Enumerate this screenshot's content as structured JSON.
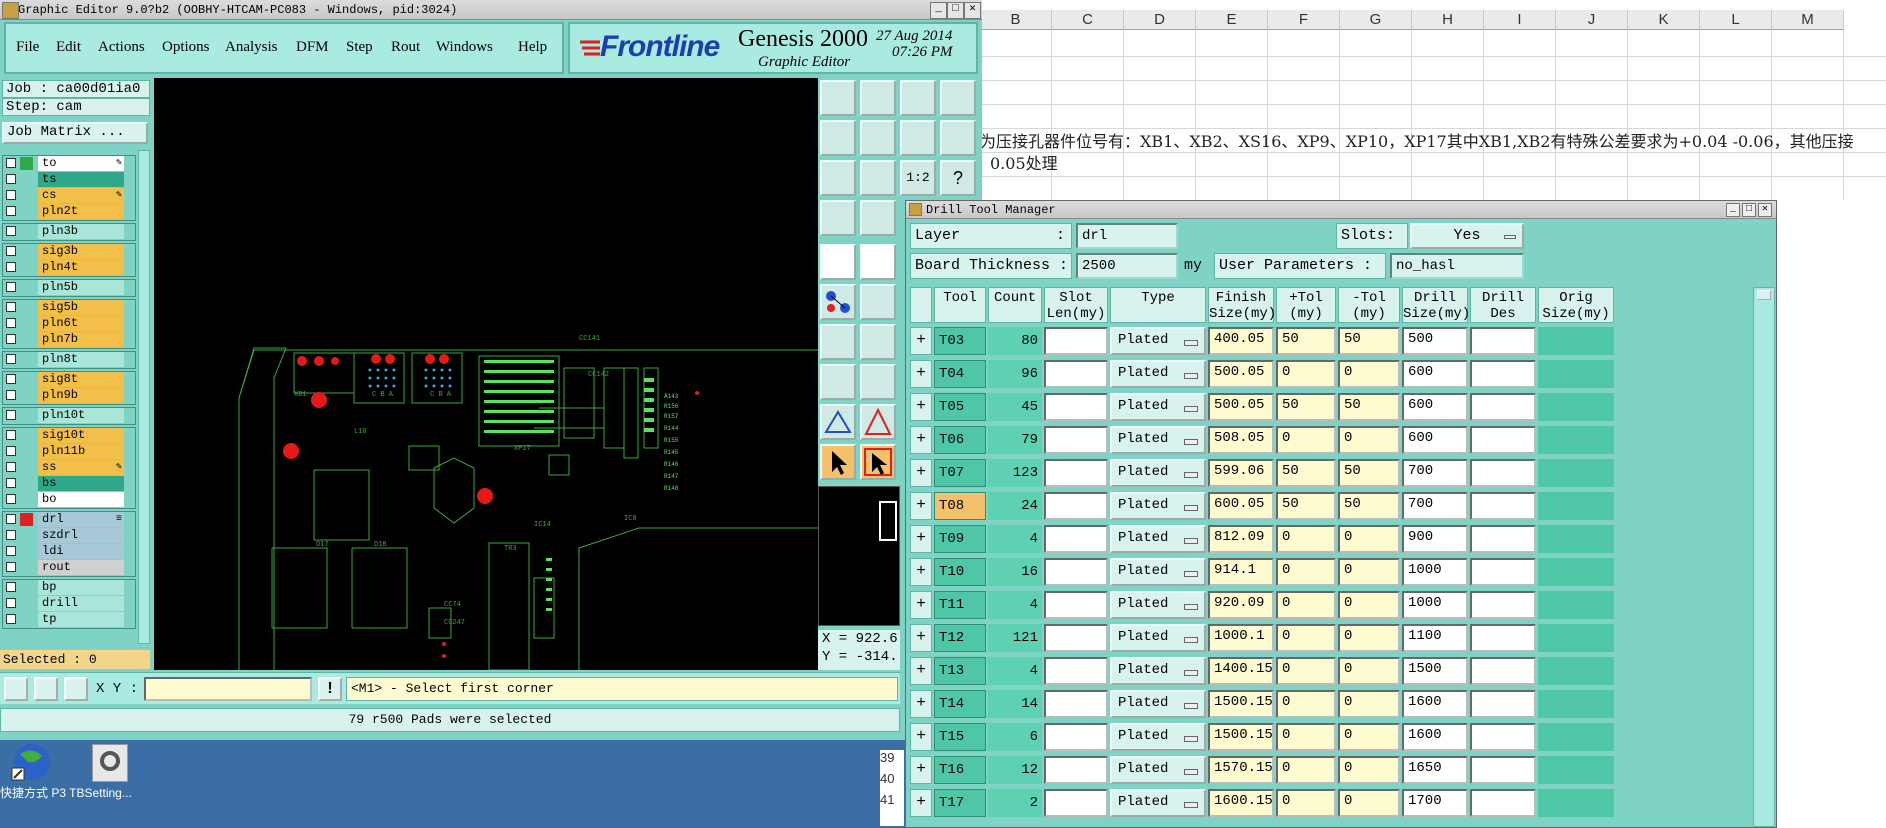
{
  "sheet": {
    "columns": [
      "B",
      "C",
      "D",
      "E",
      "F",
      "G",
      "H",
      "I",
      "J",
      "K",
      "L",
      "M"
    ],
    "note_line1": "为压接孔器件位号有：XB1、XB2、XS16、XP9、XP10，XP17其中XB1,XB2有特殊公差要求为+0.04 -0.06，其他压接",
    "note_line2": "0.05处理",
    "row_numbers": [
      "39",
      "40",
      "41"
    ]
  },
  "ge": {
    "title": "Graphic Editor 9.0?b2  (OOBHY-HTCAM-PC083 - Windows, pid:3024)",
    "menu": [
      "File",
      "Edit",
      "Actions",
      "Options",
      "Analysis",
      "DFM",
      "Step",
      "Rout",
      "Windows",
      "Help"
    ],
    "brand": "Frontline",
    "product": "Genesis 2000",
    "subtitle": "Graphic Editor",
    "date": "27 Aug 2014",
    "time": "07:26 PM",
    "job": "Job : ca00d01ia0",
    "step": "Step: cam",
    "job_matrix": "Job Matrix ...",
    "selected": "Selected : 0",
    "coords_x": "X = 922.6",
    "coords_y": "Y = -314.",
    "xy_label": "X Y :",
    "xy_value": "",
    "prompt": "<M1> - Select first corner",
    "status": "79 r500 Pads were selected",
    "layers": [
      {
        "name": "to",
        "bg": "#ffffff",
        "sw": "#2ea84a",
        "mark": "✎"
      },
      {
        "name": "ts",
        "bg": "#2ea889",
        "sw": "",
        "mark": ""
      },
      {
        "name": "cs",
        "bg": "#f2c04a",
        "sw": "",
        "mark": "✎"
      },
      {
        "name": "pln2t",
        "bg": "#f2c04a",
        "sw": "",
        "mark": ""
      },
      {
        "name": "pln3b",
        "bg": "#a8e6da",
        "sw": "",
        "mark": ""
      },
      {
        "name": "sig3b",
        "bg": "#f2c04a",
        "sw": "",
        "mark": ""
      },
      {
        "name": "pln4t",
        "bg": "#f2c04a",
        "sw": "",
        "mark": ""
      },
      {
        "name": "pln5b",
        "bg": "#a8e6da",
        "sw": "",
        "mark": ""
      },
      {
        "name": "sig5b",
        "bg": "#f2c04a",
        "sw": "",
        "mark": ""
      },
      {
        "name": "pln6t",
        "bg": "#f2c04a",
        "sw": "",
        "mark": ""
      },
      {
        "name": "pln7b",
        "bg": "#f2c04a",
        "sw": "",
        "mark": ""
      },
      {
        "name": "pln8t",
        "bg": "#a8e6da",
        "sw": "",
        "mark": ""
      },
      {
        "name": "sig8t",
        "bg": "#f2c04a",
        "sw": "",
        "mark": ""
      },
      {
        "name": "pln9b",
        "bg": "#f2c04a",
        "sw": "",
        "mark": ""
      },
      {
        "name": "pln10t",
        "bg": "#a8e6da",
        "sw": "",
        "mark": ""
      },
      {
        "name": "sig10t",
        "bg": "#f2c04a",
        "sw": "",
        "mark": ""
      },
      {
        "name": "pln11b",
        "bg": "#f2c04a",
        "sw": "",
        "mark": ""
      },
      {
        "name": "ss",
        "bg": "#f2c04a",
        "sw": "",
        "mark": "✎"
      },
      {
        "name": "bs",
        "bg": "#2ea889",
        "sw": "",
        "mark": ""
      },
      {
        "name": "bo",
        "bg": "#ffffff",
        "sw": "",
        "mark": ""
      },
      {
        "name": "drl",
        "bg": "#a8c8d8",
        "sw": "#e02020",
        "mark": "≡"
      },
      {
        "name": "szdrl",
        "bg": "#a8c8d8",
        "sw": "",
        "mark": ""
      },
      {
        "name": "ldi",
        "bg": "#a8c8d8",
        "sw": "",
        "mark": ""
      },
      {
        "name": "rout",
        "bg": "#d0d0d0",
        "sw": "",
        "mark": ""
      },
      {
        "name": "bp",
        "bg": "#a8e6da",
        "sw": "",
        "mark": ""
      },
      {
        "name": "drill",
        "bg": "#a8e6da",
        "sw": "",
        "mark": ""
      },
      {
        "name": "tp",
        "bg": "#a8e6da",
        "sw": "",
        "mark": ""
      }
    ],
    "toolbar_labels": [
      "1:2",
      "?"
    ]
  },
  "desktop": {
    "icon1": "快捷方式",
    "icon2": "P3 TBSetting..."
  },
  "dtm": {
    "title": "Drill Tool Manager",
    "layer_label": "Layer",
    "layer_value": "drl",
    "slots_label": "Slots:",
    "slots_value": "Yes",
    "thickness_label": "Board Thickness :",
    "thickness_value": "2500",
    "thickness_unit": "my",
    "user_params_label": "User Parameters :",
    "user_params_value": "no_hasl",
    "headers": [
      "Tool",
      "Count",
      "Slot\nLen(my)",
      "Type",
      "Finish\nSize(my)",
      "+Tol\n(my)",
      "-Tol\n(my)",
      "Drill\nSize(my)",
      "Drill\nDes",
      "Orig\nSize(my)"
    ],
    "rows": [
      {
        "tool": "T03",
        "count": "80",
        "slot": "",
        "type": "Plated",
        "finish": "400.05",
        "ptol": "50",
        "ntol": "50",
        "drill": "500",
        "des": ""
      },
      {
        "tool": "T04",
        "count": "96",
        "slot": "",
        "type": "Plated",
        "finish": "500.05",
        "ptol": "0",
        "ntol": "0",
        "drill": "600",
        "des": ""
      },
      {
        "tool": "T05",
        "count": "45",
        "slot": "",
        "type": "Plated",
        "finish": "500.05",
        "ptol": "50",
        "ntol": "50",
        "drill": "600",
        "des": ""
      },
      {
        "tool": "T06",
        "count": "79",
        "slot": "",
        "type": "Plated",
        "finish": "508.05",
        "ptol": "0",
        "ntol": "0",
        "drill": "600",
        "des": ""
      },
      {
        "tool": "T07",
        "count": "123",
        "slot": "",
        "type": "Plated",
        "finish": "599.06",
        "ptol": "50",
        "ntol": "50",
        "drill": "700",
        "des": ""
      },
      {
        "tool": "T08",
        "count": "24",
        "slot": "",
        "type": "Plated",
        "finish": "600.05",
        "ptol": "50",
        "ntol": "50",
        "drill": "700",
        "des": ""
      },
      {
        "tool": "T09",
        "count": "4",
        "slot": "",
        "type": "Plated",
        "finish": "812.09",
        "ptol": "0",
        "ntol": "0",
        "drill": "900",
        "des": ""
      },
      {
        "tool": "T10",
        "count": "16",
        "slot": "",
        "type": "Plated",
        "finish": "914.1",
        "ptol": "0",
        "ntol": "0",
        "drill": "1000",
        "des": ""
      },
      {
        "tool": "T11",
        "count": "4",
        "slot": "",
        "type": "Plated",
        "finish": "920.09",
        "ptol": "0",
        "ntol": "0",
        "drill": "1000",
        "des": ""
      },
      {
        "tool": "T12",
        "count": "121",
        "slot": "",
        "type": "Plated",
        "finish": "1000.1",
        "ptol": "0",
        "ntol": "0",
        "drill": "1100",
        "des": ""
      },
      {
        "tool": "T13",
        "count": "4",
        "slot": "",
        "type": "Plated",
        "finish": "1400.15",
        "ptol": "0",
        "ntol": "0",
        "drill": "1500",
        "des": ""
      },
      {
        "tool": "T14",
        "count": "14",
        "slot": "",
        "type": "Plated",
        "finish": "1500.15",
        "ptol": "0",
        "ntol": "0",
        "drill": "1600",
        "des": ""
      },
      {
        "tool": "T15",
        "count": "6",
        "slot": "",
        "type": "Plated",
        "finish": "1500.15",
        "ptol": "0",
        "ntol": "0",
        "drill": "1600",
        "des": ""
      },
      {
        "tool": "T16",
        "count": "12",
        "slot": "",
        "type": "Plated",
        "finish": "1570.15",
        "ptol": "0",
        "ntol": "0",
        "drill": "1650",
        "des": ""
      },
      {
        "tool": "T17",
        "count": "2",
        "slot": "",
        "type": "Plated",
        "finish": "1600.15",
        "ptol": "0",
        "ntol": "0",
        "drill": "1700",
        "des": ""
      }
    ],
    "selected_tool": "T08"
  }
}
